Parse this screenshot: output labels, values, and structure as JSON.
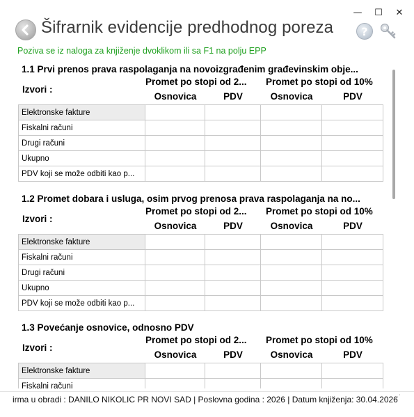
{
  "window": {
    "controls": {
      "minimize": "—",
      "maximize": "☐",
      "close": "✕"
    }
  },
  "header": {
    "title": "Šifrarnik evidencije predhodnog poreza",
    "hint": "Poziva se iz naloga za knjiženje dvoklikom ili sa F1 na polju EPP",
    "icons": {
      "back": "back-arrow-icon",
      "help": "help-icon",
      "key": "key-icon"
    }
  },
  "colors": {
    "hint": "#1fa01f",
    "title": "#3b3b3b",
    "selected_row": "#ececec"
  },
  "sections": [
    {
      "title": "1.1 Prvi prenos prava raspolaganja na novoizgrađenim građevinskim obje...",
      "sources_label": "Izvori :",
      "group1": "Promet po stopi od 2...",
      "group2": "Promet po stopi od 10%",
      "col_osnovica": "Osnovica",
      "col_pdv": "PDV",
      "rows": [
        "Elektronske fakture",
        "Fiskalni računi",
        "Drugi računi",
        "Ukupno",
        "PDV koji se može odbiti kao p..."
      ]
    },
    {
      "title": "1.2 Promet dobara i usluga, osim prvog prenosa prava raspolaganja na no...",
      "sources_label": "Izvori :",
      "group1": "Promet po stopi od 2...",
      "group2": "Promet po stopi od 10%",
      "col_osnovica": "Osnovica",
      "col_pdv": "PDV",
      "rows": [
        "Elektronske fakture",
        "Fiskalni računi",
        "Drugi računi",
        "Ukupno",
        "PDV koji se može odbiti kao p..."
      ]
    },
    {
      "title": "1.3 Povećanje osnovice, odnosno PDV",
      "sources_label": "Izvori :",
      "group1": "Promet po stopi od 2...",
      "group2": "Promet po stopi od 10%",
      "col_osnovica": "Osnovica",
      "col_pdv": "PDV",
      "rows": [
        "Elektronske fakture",
        "Fiskalni računi"
      ]
    }
  ],
  "status": {
    "text": "irma u obradi : DANILO NIKOLIC PR NOVI SAD  |  Poslovna godina : 2026  |  Datum knjiženja: 30.04.2026"
  }
}
